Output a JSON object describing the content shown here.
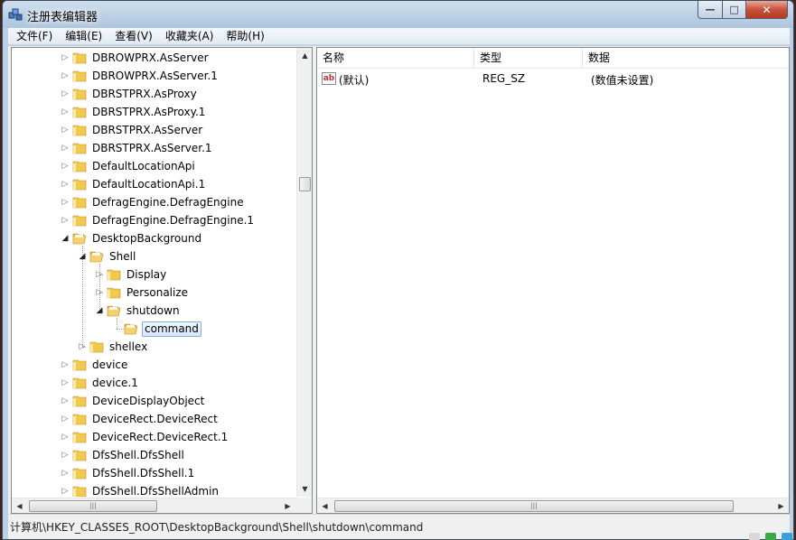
{
  "window": {
    "title": "注册表编辑器",
    "buttons": {
      "minimize": "—",
      "maximize": "□",
      "close": "✕"
    }
  },
  "menu": [
    "文件(F)",
    "编辑(E)",
    "查看(V)",
    "收藏夹(A)",
    "帮助(H)"
  ],
  "tree": {
    "items": [
      {
        "label": "DBROWPRX.AsServer",
        "depth": 0,
        "state": "collapsed"
      },
      {
        "label": "DBROWPRX.AsServer.1",
        "depth": 0,
        "state": "collapsed"
      },
      {
        "label": "DBRSTPRX.AsProxy",
        "depth": 0,
        "state": "collapsed"
      },
      {
        "label": "DBRSTPRX.AsProxy.1",
        "depth": 0,
        "state": "collapsed"
      },
      {
        "label": "DBRSTPRX.AsServer",
        "depth": 0,
        "state": "collapsed"
      },
      {
        "label": "DBRSTPRX.AsServer.1",
        "depth": 0,
        "state": "collapsed"
      },
      {
        "label": "DefaultLocationApi",
        "depth": 0,
        "state": "collapsed"
      },
      {
        "label": "DefaultLocationApi.1",
        "depth": 0,
        "state": "collapsed"
      },
      {
        "label": "DefragEngine.DefragEngine",
        "depth": 0,
        "state": "collapsed"
      },
      {
        "label": "DefragEngine.DefragEngine.1",
        "depth": 0,
        "state": "collapsed"
      },
      {
        "label": "DesktopBackground",
        "depth": 0,
        "state": "expanded"
      },
      {
        "label": "Shell",
        "depth": 1,
        "state": "expanded"
      },
      {
        "label": "Display",
        "depth": 2,
        "state": "collapsed"
      },
      {
        "label": "Personalize",
        "depth": 2,
        "state": "collapsed"
      },
      {
        "label": "shutdown",
        "depth": 2,
        "state": "expanded"
      },
      {
        "label": "command",
        "depth": 3,
        "state": "leaf",
        "selected": true
      },
      {
        "label": "shellex",
        "depth": 1,
        "state": "collapsed"
      },
      {
        "label": "device",
        "depth": 0,
        "state": "collapsed"
      },
      {
        "label": "device.1",
        "depth": 0,
        "state": "collapsed"
      },
      {
        "label": "DeviceDisplayObject",
        "depth": 0,
        "state": "collapsed"
      },
      {
        "label": "DeviceRect.DeviceRect",
        "depth": 0,
        "state": "collapsed"
      },
      {
        "label": "DeviceRect.DeviceRect.1",
        "depth": 0,
        "state": "collapsed"
      },
      {
        "label": "DfsShell.DfsShell",
        "depth": 0,
        "state": "collapsed"
      },
      {
        "label": "DfsShell.DfsShell.1",
        "depth": 0,
        "state": "collapsed"
      },
      {
        "label": "DfsShell.DfsShellAdmin",
        "depth": 0,
        "state": "collapsed"
      }
    ]
  },
  "list": {
    "columns": [
      "名称",
      "类型",
      "数据"
    ],
    "rows": [
      {
        "icon": "string-value-icon",
        "icon_text": "ab",
        "name": "(默认)",
        "type": "REG_SZ",
        "data": "(数值未设置)"
      }
    ]
  },
  "scroll_glyphs": {
    "up": "▲",
    "down": "▼",
    "left": "◀",
    "right": "▶",
    "grip": "|||"
  },
  "status": {
    "path": "计算机\\HKEY_CLASSES_ROOT\\DesktopBackground\\Shell\\shutdown\\command"
  },
  "colors": {
    "selection_border": "#84acdd",
    "folder_yellow": "#f2c94c",
    "title_gradient_top": "#d2e1f0"
  }
}
